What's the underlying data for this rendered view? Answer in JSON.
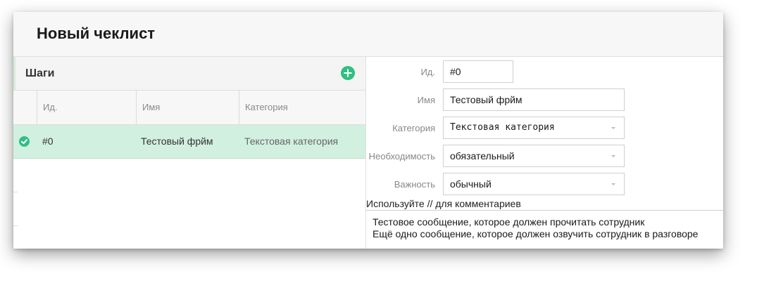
{
  "title": "Новый чеклист",
  "steps": {
    "title": "Шаги",
    "add_icon": "plus-circle-icon",
    "accent_color": "#2fbf84",
    "columns": [
      "Ид.",
      "Имя",
      "Категория"
    ],
    "rows": [
      {
        "status_icon": "check-circle-icon",
        "id": "#0",
        "name": "Тестовый фрйм",
        "category": "Текстовая категория",
        "selected": true
      }
    ]
  },
  "form": {
    "id_label": "Ид.",
    "id_value": "#0",
    "name_label": "Имя",
    "name_value": "Тестовый фрйм",
    "category_label": "Категория",
    "category_value": "Текстовая категория",
    "necessity_label": "Необходимость",
    "necessity_value": "обязательный",
    "importance_label": "Важность",
    "importance_value": "обычный",
    "hint": "Используйте // для комментариев",
    "notes": [
      "Тестовое сообщение, которое должен прочитать сотрудник",
      "Ещё одно сообщение, которое должен озвучить сотрудник в разговоре"
    ]
  }
}
